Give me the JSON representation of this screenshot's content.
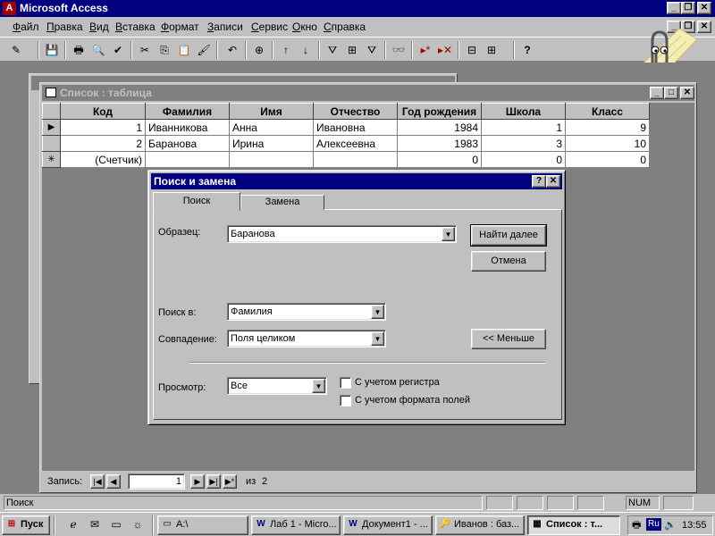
{
  "app": {
    "title": "Microsoft Access",
    "icon_text": "A"
  },
  "menu": [
    "Файл",
    "Правка",
    "Вид",
    "Вставка",
    "Формат",
    "Записи",
    "Сервис",
    "Окно",
    "Справка"
  ],
  "toolbar": {
    "icons": [
      "design-view-icon",
      "save-icon",
      "print-icon",
      "print-preview-icon",
      "spelling-icon",
      "cut-icon",
      "copy-icon",
      "paste-icon",
      "format-painter-icon",
      "undo-icon",
      "insert-hyperlink-icon",
      "sort-ascending-icon",
      "sort-descending-icon",
      "filter-by-selection-icon",
      "filter-by-form-icon",
      "apply-filter-icon",
      "find-icon",
      "new-record-icon",
      "delete-record-icon",
      "database-window-icon",
      "new-object-icon",
      "help-icon"
    ],
    "glyphs": [
      "✎",
      "💾",
      "🖶",
      "🔍",
      "✔",
      "✂",
      "⎘",
      "📋",
      "🖌",
      "↶",
      "⊕",
      "↑",
      "↓",
      "⛛",
      "⊞",
      "⛛",
      "👓",
      "▸*",
      "▸✕",
      "⊟",
      "⊞",
      "?"
    ]
  },
  "table_window": {
    "title": "Список : таблица",
    "columns": [
      "Код",
      "Фамилия",
      "Имя",
      "Отчество",
      "Год рождения",
      "Школа",
      "Класс"
    ],
    "rows": [
      {
        "selector": "▶",
        "cells": [
          "1",
          "Иванникова",
          "Анна",
          "Ивановна",
          "1984",
          "1",
          "9"
        ]
      },
      {
        "selector": "",
        "cells": [
          "2",
          "Баранова",
          "Ирина",
          "Алексеевна",
          "1983",
          "3",
          "10"
        ]
      },
      {
        "selector": "✳",
        "cells": [
          "(Счетчик)",
          "",
          "",
          "",
          "0",
          "0",
          "0"
        ]
      }
    ]
  },
  "record_nav": {
    "label": "Запись:",
    "current": "1",
    "of_label": "из",
    "total": "2"
  },
  "find_dialog": {
    "title": "Поиск и замена",
    "tabs": [
      "Поиск",
      "Замена"
    ],
    "active_tab": "Поиск",
    "pattern_label": "Образец:",
    "pattern_value": "Баранова",
    "find_next": "Найти далее",
    "cancel": "Отмена",
    "look_in_label": "Поиск в:",
    "look_in_value": "Фамилия",
    "match_label": "Совпадение:",
    "match_value": "Поля целиком",
    "less_button": "<< Меньше",
    "search_label": "Просмотр:",
    "search_value": "Все",
    "match_case": "С учетом регистра",
    "search_formatted": "С учетом формата полей",
    "match_case_checked": false,
    "search_formatted_checked": false
  },
  "status_bar": {
    "text": "Поиск",
    "num": "NUM"
  },
  "taskbar": {
    "start": "Пуск",
    "tasks": [
      {
        "label": "A:\\",
        "icon": "folder-icon",
        "glyph": "▭",
        "active": false
      },
      {
        "label": "Лаб 1 - Micro...",
        "icon": "word-icon",
        "glyph": "W",
        "active": false
      },
      {
        "label": "Документ1 - ...",
        "icon": "word-icon",
        "glyph": "W",
        "active": false
      },
      {
        "label": "Иванов : баз...",
        "icon": "access-db-icon",
        "glyph": "🔑",
        "active": false
      },
      {
        "label": "Список : т...",
        "icon": "table-icon",
        "glyph": "▦",
        "active": true
      }
    ],
    "lang": "Ru",
    "clock": "13:55"
  }
}
